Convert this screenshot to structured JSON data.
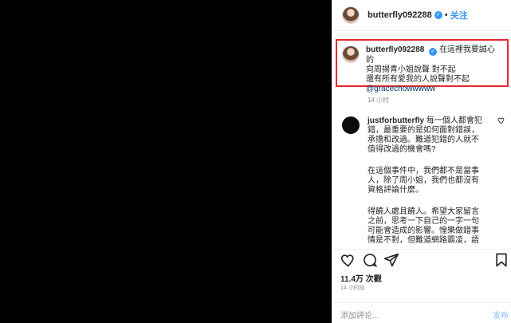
{
  "header": {
    "username": "butterfly092288",
    "separator": "•",
    "follow_label": "关注",
    "verified_glyph": "✓"
  },
  "caption": {
    "username": "butterfly092288",
    "line1_tail": "在這裡我要誠心的",
    "line2": "向周揚青小姐說聲 對不起",
    "line3": "還有所有愛我的人說聲對不起",
    "mention": "@gracechowwwww",
    "time": "14 小时"
  },
  "comment": {
    "username": "justforbutterfly",
    "p1": "每一個人都會犯錯，最重要的是如何面對錯誤，承擔和改過。難道犯錯的人就不值得改過的機會嗎?",
    "p2": "在這個事件中，我們都不是當事人，除了周小姐，我們也都沒有資格評論什麼。",
    "p3": "得饒人處且饒人。希望大家留言之前，思考一下自己的一字一句可能會造成的影響。惶樂做錯事情是不對，但難道網路霸凌，語"
  },
  "actions": {
    "views": "11.4万 次觀",
    "time": "14 小时前",
    "comment_placeholder": "添加評论...",
    "post_label": "发布"
  },
  "icons": [
    "heart-icon",
    "comment-icon",
    "share-icon",
    "bookmark-icon",
    "verified-icon",
    "avatar"
  ],
  "colors": {
    "accent": "#3897f0",
    "highlight_border": "#e5282d",
    "muted": "#8e8e8e"
  }
}
